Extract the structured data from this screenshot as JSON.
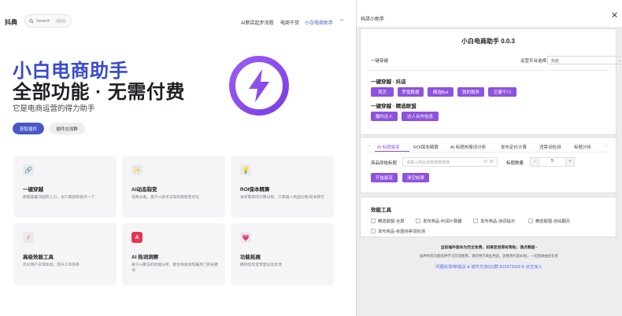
{
  "site": {
    "brand": "抖典",
    "search": {
      "placeholder": "Search",
      "shortcut": "Ctrl K"
    },
    "nav": [
      "AI新店起步流程",
      "电商干货",
      "小白电商助手"
    ],
    "nav_more": "···",
    "hero": {
      "title_line1": "小白电商助手",
      "title_line2": "全部功能 · 无需付费",
      "subtitle": "它是电商运营的得力助手",
      "primary_button": "获取插件",
      "secondary_button": "插件交流群"
    },
    "features": [
      {
        "icon": "link-icon",
        "glyph": "🔗",
        "title": "一键穿越",
        "desc": "新链是最深层的入口，也只需鼠标轻点一下"
      },
      {
        "icon": "sparkles-icon",
        "glyph": "✨",
        "title": "AI动态裂变",
        "desc": "电商必备，基于AI技术实现标题裂变优化"
      },
      {
        "icon": "lightbulb-icon",
        "glyph": "💡",
        "title": "ROI保本精算",
        "desc": "省却繁琐的计算过程，只需填入商品价格/成本即可"
      },
      {
        "icon": "bolt-icon",
        "glyph": "⚡",
        "title": "高级效能工具",
        "desc": "优化用户日常体验，提升工作效率"
      },
      {
        "icon": "ai-icon",
        "glyph": "A",
        "title": "AI 热词洞察",
        "desc": "基于AI算法的智能分析，助你快速发现最热门的关键词"
      },
      {
        "icon": "heart-icon",
        "glyph": "💗",
        "title": "功能拓展",
        "desc": "期待您的宝贵建议及反馈"
      }
    ]
  },
  "panel": {
    "header_title": "抖店小助手",
    "close_glyph": "✕",
    "app_title": "小白电商助手 0.0.3",
    "one_click_label": "一键穿越",
    "platform_label": "运营平台选择",
    "platform_value": "抖店",
    "section1_title": "一键穿越 · 抖店",
    "section1_buttons": [
      "首页",
      "罗盘数据",
      "精选But",
      "我的服务",
      "巨量千川"
    ],
    "section2_title": "一键穿越 · 精选联盟",
    "section2_buttons": [
      "履约达人",
      "达人合作信息"
    ],
    "tabs": [
      "‹",
      "AI 标题裂变",
      "ROI保本精算",
      "AI 标题热搜词分析",
      "发布定价计算",
      "违禁词检测",
      "标题分析",
      "›"
    ],
    "title_input_label": "商品原始标题",
    "title_input_placeholder": "请输入商品标题或者链接",
    "title_input_counter": "0 / 30",
    "count_label": "标题数量",
    "count_minus": "−",
    "count_value": "5",
    "count_plus": "+",
    "action_buttons": [
      "开始裂变",
      "清空结果"
    ],
    "tools_title": "效能工具",
    "tools": [
      "精选联盟-全屏",
      "发布商品-利润计算器",
      "发布商品-违词提示",
      "精选联盟-自动翻页",
      "发布商品-标题违禁词检测"
    ],
    "footer_notice": "当前插件版本为完全免费，如果您觉得有帮助，请点颗星~",
    "footer_sub": "插件所有功能仅供学习交流使用，请勿用于商业用途，因使用引起纠纷，一切后果由您负责",
    "footer_links": "问题反馈/新提议 & 插件交流QQ群 813373918 & 点击加入"
  }
}
